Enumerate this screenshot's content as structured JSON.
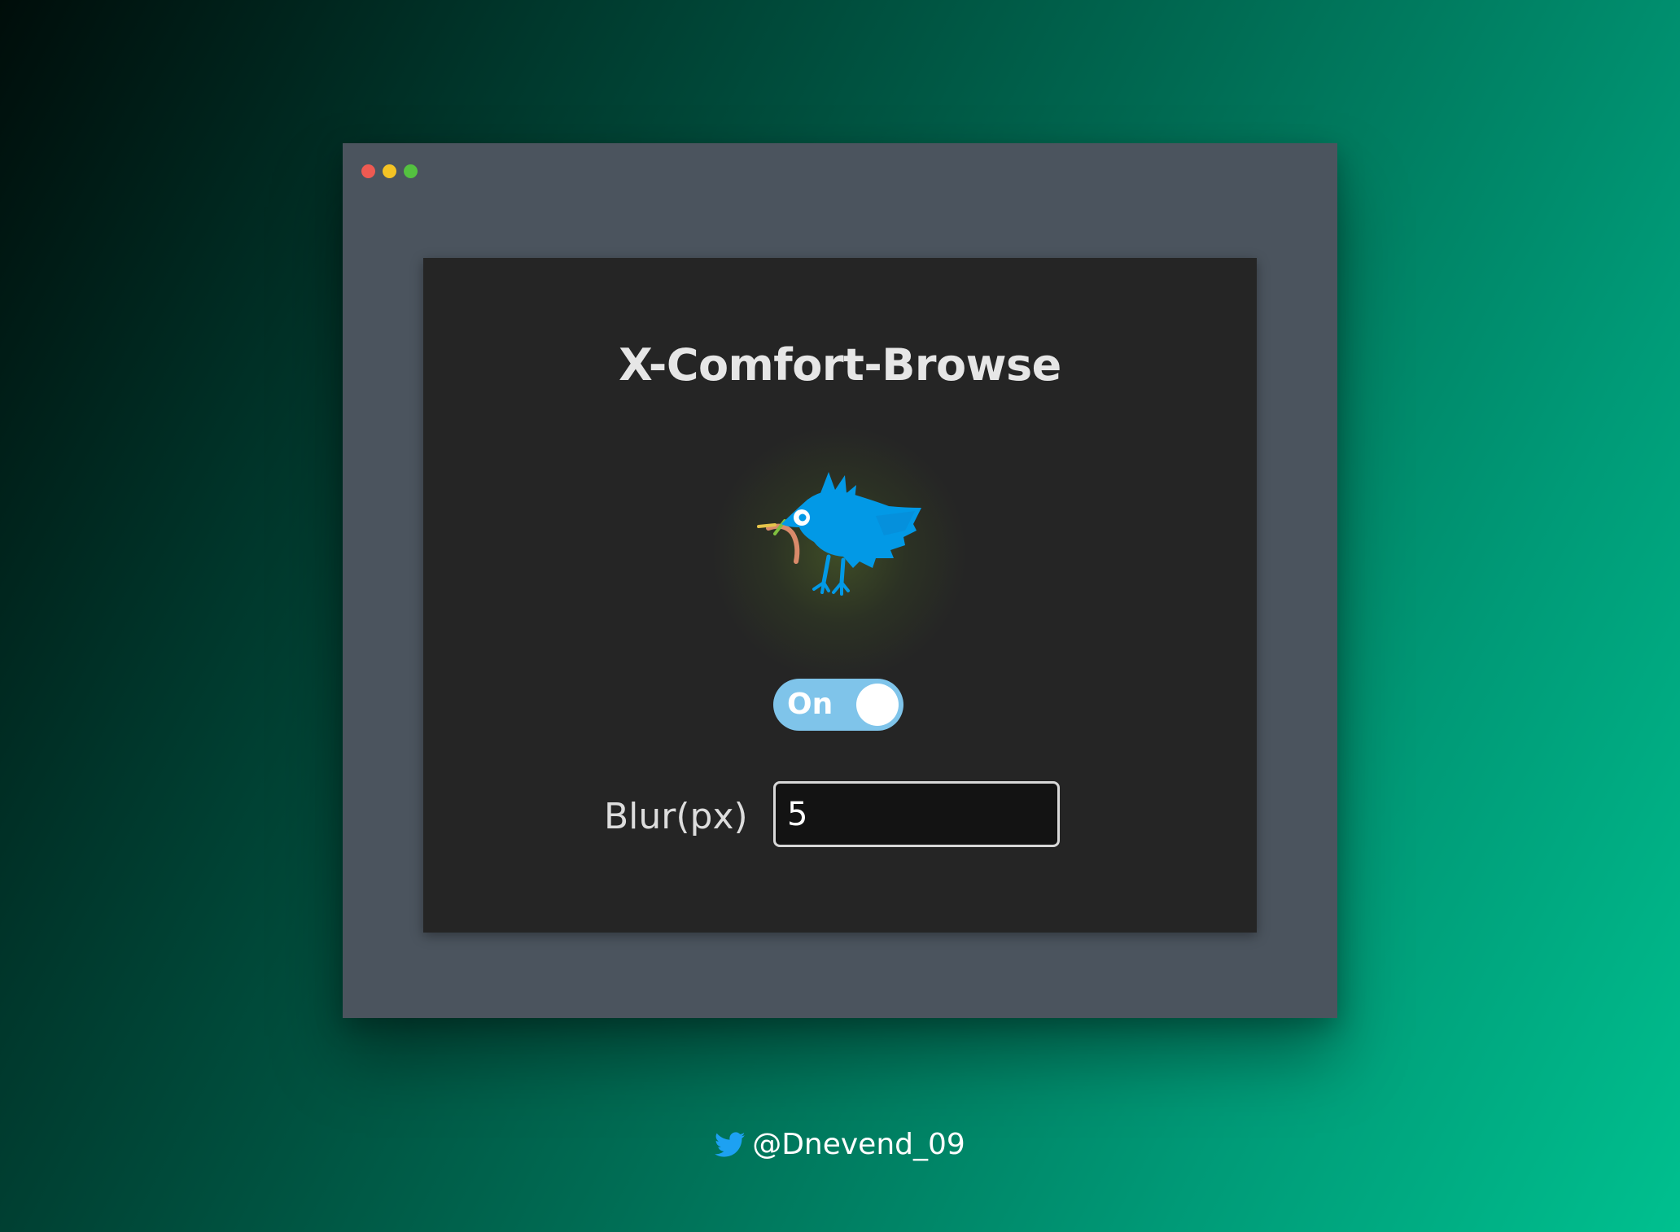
{
  "app": {
    "title": "X-Comfort-Browse"
  },
  "window_controls": [
    "close",
    "minimize",
    "maximize"
  ],
  "logo": {
    "icon": "bird-with-worm-icon",
    "color": "#0299e6"
  },
  "toggle": {
    "label": "On",
    "state": true,
    "color": "#7fc4ea"
  },
  "blur": {
    "label": "Blur(px)",
    "value": "5"
  },
  "credit": {
    "icon": "twitter-bird-icon",
    "handle": "@Dnevend_09"
  },
  "colors": {
    "window": "#4b545e",
    "panel": "#252525",
    "accent": "#1da1f2",
    "close": "#ee5a52",
    "minimize": "#f4c324",
    "maximize": "#54c140"
  }
}
